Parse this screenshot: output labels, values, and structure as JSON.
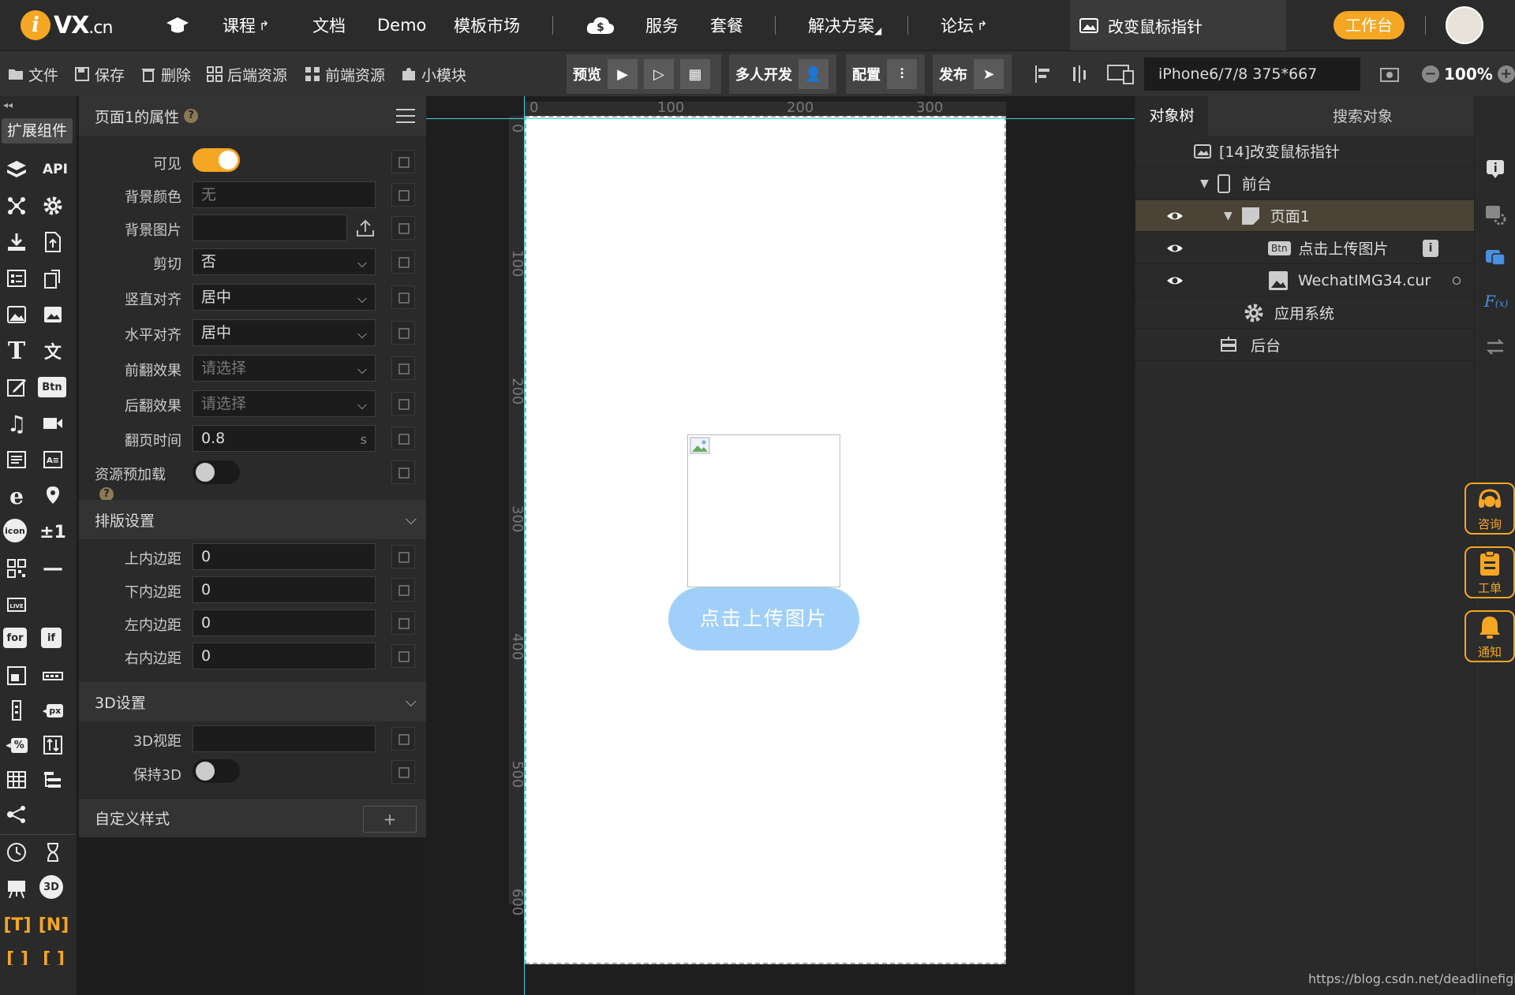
{
  "topbar": {
    "logo_letter": "i",
    "logo_text": "VX",
    "logo_suffix": ".cn",
    "nav": {
      "course": "课程",
      "docs": "文档",
      "demo": "Demo",
      "templates": "模板市场",
      "services": "服务",
      "plans": "套餐",
      "solutions": "解决方案",
      "forum": "论坛"
    },
    "active_tab": "改变鼠标指针",
    "workbench": "工作台"
  },
  "toolbar": {
    "file": "文件",
    "save": "保存",
    "delete": "删除",
    "backend": "后端资源",
    "frontend": "前端资源",
    "module": "小模块",
    "preview": "预览",
    "collab": "多人开发",
    "config": "配置",
    "publish": "发布",
    "device": "iPhone6/7/8 375*667",
    "zoom": "100%"
  },
  "leftpanel": {
    "ext_label": "扩展组件",
    "api": "API",
    "btn": "Btn",
    "icon": "icon",
    "plusminus": "±1",
    "live": "LIVE",
    "for": "for",
    "if": "if",
    "px": "px",
    "pct": "%",
    "threed": "3D",
    "t": "[T]",
    "n": "[N]"
  },
  "props": {
    "title": "页面1的属性",
    "visible": "可见",
    "bg_color": "背景颜色",
    "bg_color_val": "无",
    "bg_image": "背景图片",
    "clip": "剪切",
    "clip_val": "否",
    "valign": "竖直对齐",
    "valign_val": "居中",
    "halign": "水平对齐",
    "halign_val": "居中",
    "flip_front": "前翻效果",
    "flip_front_ph": "请选择",
    "flip_back": "后翻效果",
    "flip_back_ph": "请选择",
    "flip_time": "翻页时间",
    "flip_time_val": "0.8",
    "flip_time_unit": "s",
    "preload": "资源预加载",
    "layout_section": "排版设置",
    "pad_top": "上内边距",
    "pad_top_val": "0",
    "pad_bottom": "下内边距",
    "pad_bottom_val": "0",
    "pad_left": "左内边距",
    "pad_left_val": "0",
    "pad_right": "右内边距",
    "pad_right_val": "0",
    "threed_section": "3D设置",
    "perspective": "3D视距",
    "keep3d": "保持3D",
    "custom_style": "自定义样式",
    "add": "+"
  },
  "canvas": {
    "hticks": [
      "0",
      "100",
      "200",
      "300"
    ],
    "vticks": [
      "0",
      "100",
      "200",
      "300",
      "400",
      "500",
      "600"
    ],
    "upload_button": "点击上传图片"
  },
  "tree": {
    "tab": "对象树",
    "search": "搜索对象",
    "nodes": {
      "app": "[14]改变鼠标指针",
      "front": "前台",
      "page1": "页面1",
      "btn": "点击上传图片",
      "btn_badge": "Btn",
      "img": "WechatIMG34.cur",
      "system": "应用系统",
      "back": "后台"
    }
  },
  "float": {
    "consult": "咨询",
    "ticket": "工单",
    "notify": "通知"
  },
  "watermark": "https://blog.csdn.net/deadlinefighter",
  "colors": {
    "accent": "#f5a623",
    "upload_button": "#a0d0f9",
    "guide": "#3ad3e6"
  }
}
